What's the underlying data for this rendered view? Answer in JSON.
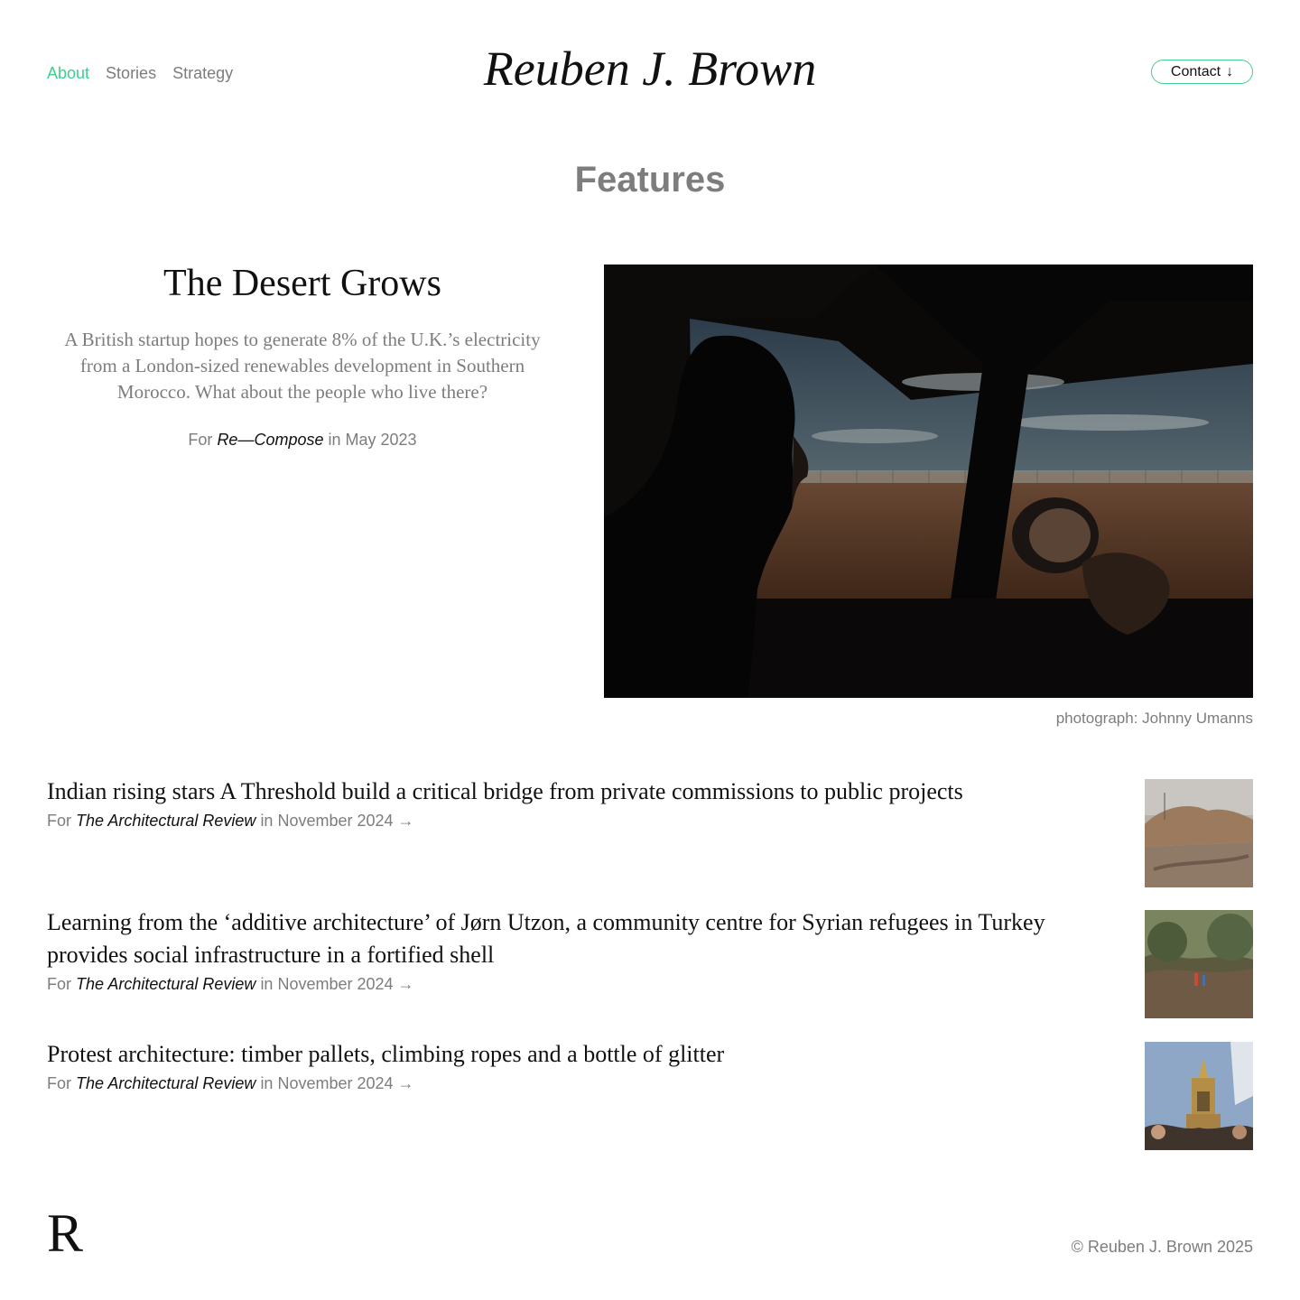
{
  "header": {
    "nav": [
      {
        "label": "About",
        "active": true
      },
      {
        "label": "Stories",
        "active": false
      },
      {
        "label": "Strategy",
        "active": false
      }
    ],
    "site_title": "Reuben J. Brown",
    "contact_label": "Contact",
    "contact_icon": "↓"
  },
  "colors": {
    "accent": "#3ecf8e",
    "muted": "#7d7d7d",
    "text": "#111111"
  },
  "section_heading": "Features",
  "hero": {
    "title": "The Desert Grows",
    "description": "A British startup hopes to generate 8% of the U.K.’s electricity from a London-sized renewables development in Southern Morocco. What about the people who live there?",
    "meta_prefix": "For",
    "publication": "Re—Compose",
    "meta_suffix": "in May 2023",
    "photo_credit": "photograph: Johnny Umanns"
  },
  "stories": [
    {
      "title": "Indian rising stars A Threshold build a critical bridge from private commissions to public projects",
      "meta_prefix": "For",
      "publication": "The Architectural Review",
      "meta_suffix": "in November 2024 →"
    },
    {
      "title": "Learning from the ‘additive architecture’ of Jørn Utzon, a community centre for Syrian refugees in Turkey provides social infrastructure in a fortified shell",
      "meta_prefix": "For",
      "publication": "The Architectural Review",
      "meta_suffix": "in November 2024 →"
    },
    {
      "title": "Protest architecture: timber pallets, climbing ropes and a bottle of glitter",
      "meta_prefix": "For",
      "publication": "The Architectural Review",
      "meta_suffix": "in November 2024 →"
    }
  ],
  "footer": {
    "logo_letter": "R",
    "copyright": "© Reuben J. Brown 2025"
  }
}
